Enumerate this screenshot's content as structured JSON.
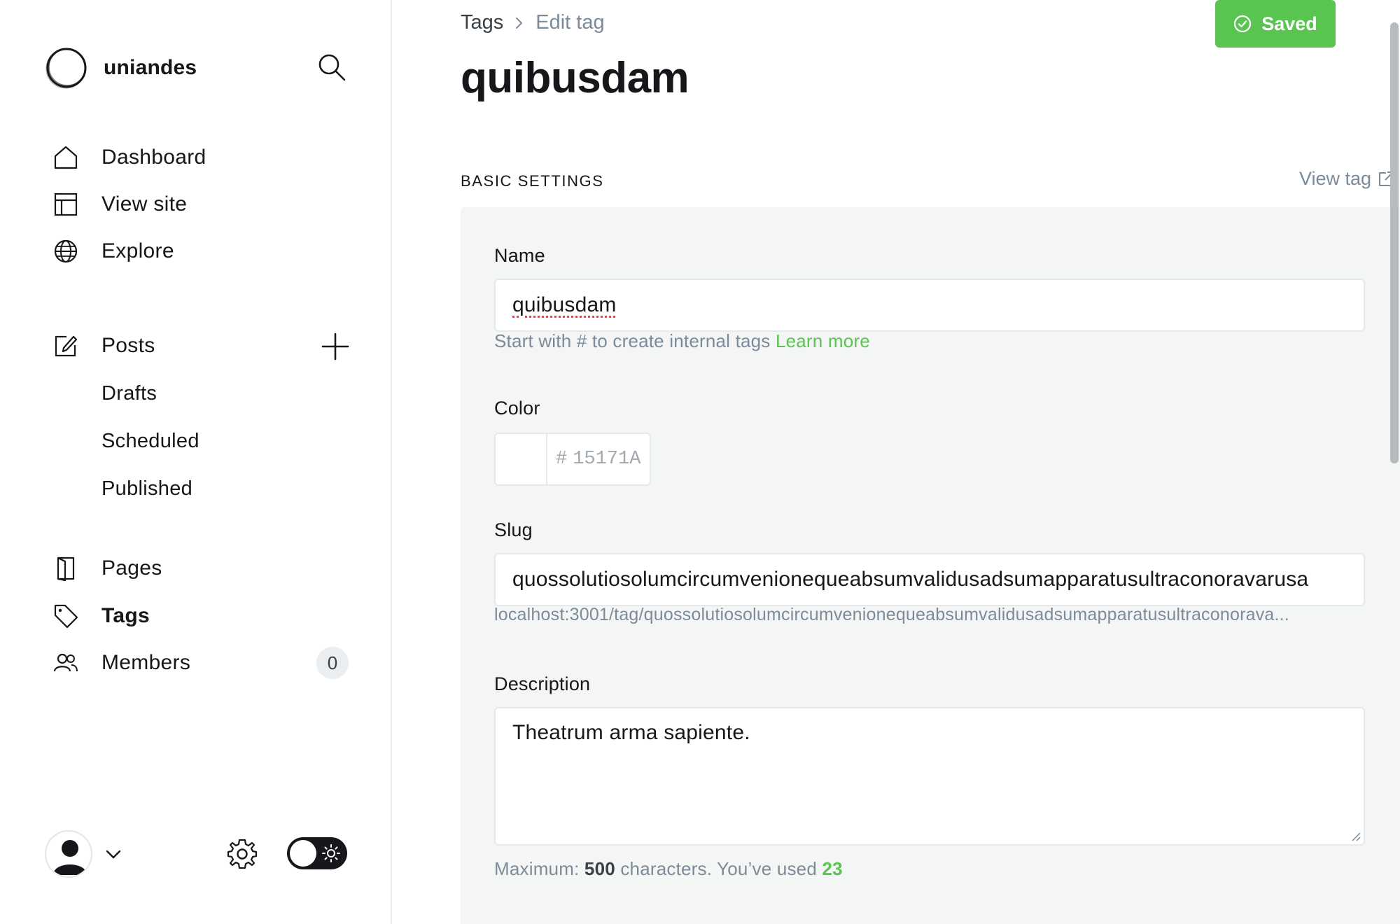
{
  "brand": {
    "name": "uniandes"
  },
  "sidebar": {
    "items": [
      {
        "label": "Dashboard"
      },
      {
        "label": "View site"
      },
      {
        "label": "Explore"
      },
      {
        "label": "Posts"
      },
      {
        "label": "Pages"
      },
      {
        "label": "Tags"
      },
      {
        "label": "Members"
      }
    ],
    "posts_sub": [
      "Drafts",
      "Scheduled",
      "Published"
    ],
    "members_count": "0",
    "icons": [
      "search-icon",
      "home-icon",
      "layout-icon",
      "globe-icon",
      "edit-icon",
      "plus-icon",
      "page-icon",
      "tag-icon",
      "members-icon",
      "user-icon",
      "chevron-down-icon",
      "gear-icon",
      "sun-icon"
    ]
  },
  "header": {
    "breadcrumb_parent": "Tags",
    "breadcrumb_current": "Edit tag",
    "saved_label": "Saved",
    "title": "quibusdam"
  },
  "section": {
    "title": "BASIC SETTINGS",
    "view_link": "View tag"
  },
  "form": {
    "name_label": "Name",
    "name_value": "quibusdam",
    "name_hint": "Start with # to create internal tags",
    "name_hint_link": "Learn more",
    "color_label": "Color",
    "color_hash": "#",
    "color_placeholder": "15171A",
    "slug_label": "Slug",
    "slug_value": "quossolutiosolumcircumvenionequeabsumvalidusadsumapparatusultraconoravarusa",
    "slug_url": "localhost:3001/tag/quossolutiosolumcircumvenionequeabsumvalidusadsumapparatusultraconorava...",
    "description_label": "Description",
    "description_value": "Theatrum arma sapiente.",
    "desc_hint_prefix": "Maximum: ",
    "desc_hint_max": "500",
    "desc_hint_middle": " characters. You’ve used ",
    "desc_hint_used": "23"
  },
  "colors": {
    "accent": "#5ac451",
    "text": "#15171a",
    "muted": "#7c8b9a",
    "panel": "#f4f5f5"
  }
}
